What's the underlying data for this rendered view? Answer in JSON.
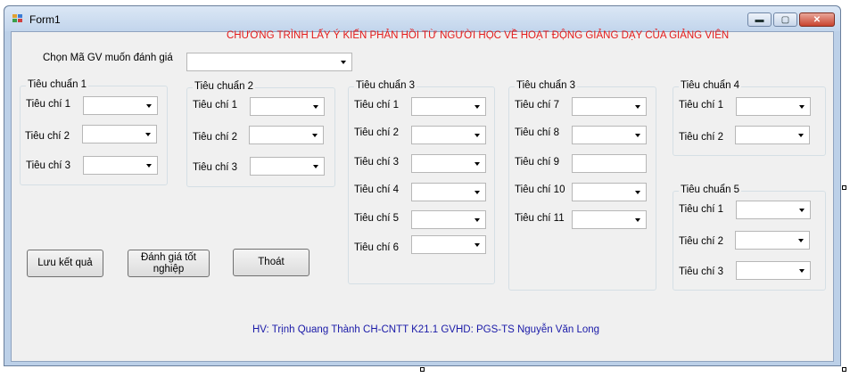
{
  "window": {
    "title": "Form1",
    "controls": {
      "minimize": "▬",
      "maximize": "▢",
      "close": "✕"
    }
  },
  "heading": "CHƯƠNG TRÌNH LẤY Ý KIẾN PHẢN HỒI TỪ NGƯỜI HỌC VỀ HOẠT ĐỘNG GIẢNG DẠY CỦA GIẢNG VIÊN",
  "teacher_select": {
    "label": "Chọn Mã GV muốn đánh giá",
    "value": ""
  },
  "groups": [
    {
      "title": "Tiêu chuẩn 1",
      "criteria": [
        {
          "label": "Tiêu chí 1",
          "value": ""
        },
        {
          "label": "Tiêu chí 2",
          "value": ""
        },
        {
          "label": "Tiêu chí 3",
          "value": ""
        }
      ]
    },
    {
      "title": "Tiêu chuẩn 2",
      "criteria": [
        {
          "label": "Tiêu chí 1",
          "value": ""
        },
        {
          "label": "Tiêu chí 2",
          "value": ""
        },
        {
          "label": "Tiêu chí 3",
          "value": ""
        }
      ]
    },
    {
      "title": "Tiêu chuẩn 3",
      "criteria": [
        {
          "label": "Tiêu chí 1",
          "value": ""
        },
        {
          "label": "Tiêu chí 2",
          "value": ""
        },
        {
          "label": "Tiêu chí 3",
          "value": ""
        },
        {
          "label": "Tiêu chí 4",
          "value": ""
        },
        {
          "label": "Tiêu chí 5",
          "value": ""
        },
        {
          "label": "Tiêu chí 6",
          "value": ""
        }
      ]
    },
    {
      "title": "Tiêu chuẩn 3",
      "criteria": [
        {
          "label": "Tiêu chí 7",
          "value": ""
        },
        {
          "label": "Tiêu chí 8",
          "value": ""
        },
        {
          "label": "Tiêu chí 9",
          "value": ""
        },
        {
          "label": "Tiêu chí 10",
          "value": ""
        },
        {
          "label": "Tiêu chí 11",
          "value": ""
        }
      ]
    },
    {
      "title": "Tiêu chuẩn 4",
      "criteria": [
        {
          "label": "Tiêu chí 1",
          "value": ""
        },
        {
          "label": "Tiêu chí 2",
          "value": ""
        }
      ]
    },
    {
      "title": "Tiêu chuẩn 5",
      "criteria": [
        {
          "label": "Tiêu chí 1",
          "value": ""
        },
        {
          "label": "Tiêu chí 2",
          "value": ""
        },
        {
          "label": "Tiêu chí 3",
          "value": ""
        }
      ]
    }
  ],
  "buttons": {
    "save": "Lưu kết quả",
    "evaluate": "Đánh giá tốt nghiệp",
    "exit": "Thoát"
  },
  "footer": "HV: Trịnh Quang Thành CH-CNTT K21.1    GVHD: PGS-TS Nguyễn Văn Long"
}
